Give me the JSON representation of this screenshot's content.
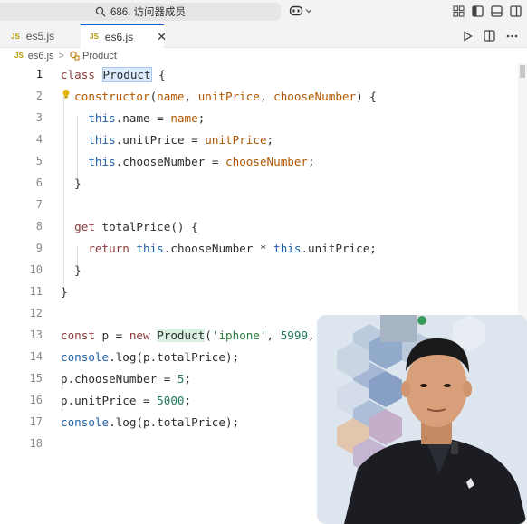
{
  "titlebar": {
    "search_text": "686. 访问器成员"
  },
  "tabs": [
    {
      "label": "es5.js",
      "badge": "JS",
      "active": false
    },
    {
      "label": "es6.js",
      "badge": "JS",
      "active": true,
      "close": "✕"
    }
  ],
  "breadcrumb": {
    "badge": "JS",
    "file": "es6.js",
    "sep": ">",
    "symbol": "Product"
  },
  "editor": {
    "current_line": 1,
    "lines": [
      {
        "n": "1",
        "tokens": [
          [
            "kw",
            "class"
          ],
          [
            "t",
            " "
          ],
          [
            "hl",
            "Product"
          ],
          [
            "t",
            " {"
          ]
        ]
      },
      {
        "n": "2",
        "tokens": [
          [
            "t",
            "  "
          ],
          [
            "kw2",
            "constructor"
          ],
          [
            "t",
            "("
          ],
          [
            "var",
            "name"
          ],
          [
            "t",
            ", "
          ],
          [
            "var",
            "unitPrice"
          ],
          [
            "t",
            ", "
          ],
          [
            "var",
            "chooseNumber"
          ],
          [
            "t",
            ") {"
          ]
        ]
      },
      {
        "n": "3",
        "tokens": [
          [
            "t",
            "    "
          ],
          [
            "prop",
            "this"
          ],
          [
            "t",
            "."
          ],
          [
            "fn",
            "name"
          ],
          [
            "t",
            " = "
          ],
          [
            "var",
            "name"
          ],
          [
            "t",
            ";"
          ]
        ]
      },
      {
        "n": "4",
        "tokens": [
          [
            "t",
            "    "
          ],
          [
            "prop",
            "this"
          ],
          [
            "t",
            "."
          ],
          [
            "fn",
            "unitPrice"
          ],
          [
            "t",
            " = "
          ],
          [
            "var",
            "unitPrice"
          ],
          [
            "t",
            ";"
          ]
        ]
      },
      {
        "n": "5",
        "tokens": [
          [
            "t",
            "    "
          ],
          [
            "prop",
            "this"
          ],
          [
            "t",
            "."
          ],
          [
            "fn",
            "chooseNumber"
          ],
          [
            "t",
            " = "
          ],
          [
            "var",
            "chooseNumber"
          ],
          [
            "t",
            ";"
          ]
        ]
      },
      {
        "n": "6",
        "tokens": [
          [
            "t",
            "  }"
          ]
        ]
      },
      {
        "n": "7",
        "tokens": []
      },
      {
        "n": "8",
        "tokens": [
          [
            "t",
            "  "
          ],
          [
            "kw",
            "get"
          ],
          [
            "t",
            " totalPrice() {"
          ]
        ]
      },
      {
        "n": "9",
        "tokens": [
          [
            "t",
            "    "
          ],
          [
            "kw",
            "return"
          ],
          [
            "t",
            " "
          ],
          [
            "prop",
            "this"
          ],
          [
            "t",
            ".chooseNumber * "
          ],
          [
            "prop",
            "this"
          ],
          [
            "t",
            ".unitPrice;"
          ]
        ]
      },
      {
        "n": "10",
        "tokens": [
          [
            "t",
            "  }"
          ]
        ]
      },
      {
        "n": "11",
        "tokens": [
          [
            "t",
            "}"
          ]
        ]
      },
      {
        "n": "12",
        "tokens": []
      },
      {
        "n": "13",
        "tokens": [
          [
            "kw",
            "const"
          ],
          [
            "t",
            " p = "
          ],
          [
            "kw",
            "new"
          ],
          [
            "t",
            " "
          ],
          [
            "hl2",
            "Product"
          ],
          [
            "t",
            "("
          ],
          [
            "str",
            "'iphone'"
          ],
          [
            "t",
            ", "
          ],
          [
            "num",
            "5999"
          ],
          [
            "t",
            ", 3"
          ]
        ]
      },
      {
        "n": "14",
        "tokens": [
          [
            "prop",
            "console"
          ],
          [
            "t",
            ".log(p.totalPrice);"
          ]
        ]
      },
      {
        "n": "15",
        "tokens": [
          [
            "t",
            "p.chooseNumber = "
          ],
          [
            "num",
            "5"
          ],
          [
            "t",
            ";"
          ]
        ]
      },
      {
        "n": "16",
        "tokens": [
          [
            "t",
            "p.unitPrice = "
          ],
          [
            "num",
            "5000"
          ],
          [
            "t",
            ";"
          ]
        ]
      },
      {
        "n": "17",
        "tokens": [
          [
            "prop",
            "console"
          ],
          [
            "t",
            ".log(p.totalPrice);"
          ]
        ]
      },
      {
        "n": "18",
        "tokens": []
      }
    ]
  },
  "colors": {
    "accent": "#0a64d6",
    "js_badge": "#b59a00"
  },
  "icons": [
    "search-icon",
    "copilot-icon",
    "chevron-down-icon",
    "layout-icon",
    "primary-sidebar-icon",
    "panel-icon",
    "secondary-sidebar-icon",
    "run-icon",
    "split-editor-icon",
    "more-icon",
    "lightbulb-icon",
    "symbol-class-icon"
  ]
}
